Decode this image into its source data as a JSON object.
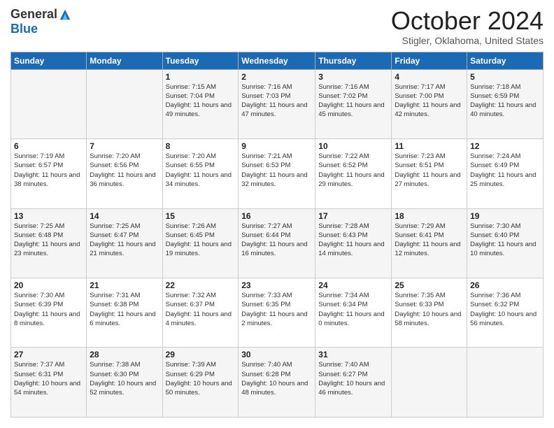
{
  "logo": {
    "general": "General",
    "blue": "Blue"
  },
  "header": {
    "month": "October 2024",
    "location": "Stigler, Oklahoma, United States"
  },
  "days_of_week": [
    "Sunday",
    "Monday",
    "Tuesday",
    "Wednesday",
    "Thursday",
    "Friday",
    "Saturday"
  ],
  "weeks": [
    [
      {
        "day": "",
        "sunrise": "",
        "sunset": "",
        "daylight": ""
      },
      {
        "day": "",
        "sunrise": "",
        "sunset": "",
        "daylight": ""
      },
      {
        "day": "1",
        "sunrise": "Sunrise: 7:15 AM",
        "sunset": "Sunset: 7:04 PM",
        "daylight": "Daylight: 11 hours and 49 minutes."
      },
      {
        "day": "2",
        "sunrise": "Sunrise: 7:16 AM",
        "sunset": "Sunset: 7:03 PM",
        "daylight": "Daylight: 11 hours and 47 minutes."
      },
      {
        "day": "3",
        "sunrise": "Sunrise: 7:16 AM",
        "sunset": "Sunset: 7:02 PM",
        "daylight": "Daylight: 11 hours and 45 minutes."
      },
      {
        "day": "4",
        "sunrise": "Sunrise: 7:17 AM",
        "sunset": "Sunset: 7:00 PM",
        "daylight": "Daylight: 11 hours and 42 minutes."
      },
      {
        "day": "5",
        "sunrise": "Sunrise: 7:18 AM",
        "sunset": "Sunset: 6:59 PM",
        "daylight": "Daylight: 11 hours and 40 minutes."
      }
    ],
    [
      {
        "day": "6",
        "sunrise": "Sunrise: 7:19 AM",
        "sunset": "Sunset: 6:57 PM",
        "daylight": "Daylight: 11 hours and 38 minutes."
      },
      {
        "day": "7",
        "sunrise": "Sunrise: 7:20 AM",
        "sunset": "Sunset: 6:56 PM",
        "daylight": "Daylight: 11 hours and 36 minutes."
      },
      {
        "day": "8",
        "sunrise": "Sunrise: 7:20 AM",
        "sunset": "Sunset: 6:55 PM",
        "daylight": "Daylight: 11 hours and 34 minutes."
      },
      {
        "day": "9",
        "sunrise": "Sunrise: 7:21 AM",
        "sunset": "Sunset: 6:53 PM",
        "daylight": "Daylight: 11 hours and 32 minutes."
      },
      {
        "day": "10",
        "sunrise": "Sunrise: 7:22 AM",
        "sunset": "Sunset: 6:52 PM",
        "daylight": "Daylight: 11 hours and 29 minutes."
      },
      {
        "day": "11",
        "sunrise": "Sunrise: 7:23 AM",
        "sunset": "Sunset: 6:51 PM",
        "daylight": "Daylight: 11 hours and 27 minutes."
      },
      {
        "day": "12",
        "sunrise": "Sunrise: 7:24 AM",
        "sunset": "Sunset: 6:49 PM",
        "daylight": "Daylight: 11 hours and 25 minutes."
      }
    ],
    [
      {
        "day": "13",
        "sunrise": "Sunrise: 7:25 AM",
        "sunset": "Sunset: 6:48 PM",
        "daylight": "Daylight: 11 hours and 23 minutes."
      },
      {
        "day": "14",
        "sunrise": "Sunrise: 7:25 AM",
        "sunset": "Sunset: 6:47 PM",
        "daylight": "Daylight: 11 hours and 21 minutes."
      },
      {
        "day": "15",
        "sunrise": "Sunrise: 7:26 AM",
        "sunset": "Sunset: 6:45 PM",
        "daylight": "Daylight: 11 hours and 19 minutes."
      },
      {
        "day": "16",
        "sunrise": "Sunrise: 7:27 AM",
        "sunset": "Sunset: 6:44 PM",
        "daylight": "Daylight: 11 hours and 16 minutes."
      },
      {
        "day": "17",
        "sunrise": "Sunrise: 7:28 AM",
        "sunset": "Sunset: 6:43 PM",
        "daylight": "Daylight: 11 hours and 14 minutes."
      },
      {
        "day": "18",
        "sunrise": "Sunrise: 7:29 AM",
        "sunset": "Sunset: 6:41 PM",
        "daylight": "Daylight: 11 hours and 12 minutes."
      },
      {
        "day": "19",
        "sunrise": "Sunrise: 7:30 AM",
        "sunset": "Sunset: 6:40 PM",
        "daylight": "Daylight: 11 hours and 10 minutes."
      }
    ],
    [
      {
        "day": "20",
        "sunrise": "Sunrise: 7:30 AM",
        "sunset": "Sunset: 6:39 PM",
        "daylight": "Daylight: 11 hours and 8 minutes."
      },
      {
        "day": "21",
        "sunrise": "Sunrise: 7:31 AM",
        "sunset": "Sunset: 6:38 PM",
        "daylight": "Daylight: 11 hours and 6 minutes."
      },
      {
        "day": "22",
        "sunrise": "Sunrise: 7:32 AM",
        "sunset": "Sunset: 6:37 PM",
        "daylight": "Daylight: 11 hours and 4 minutes."
      },
      {
        "day": "23",
        "sunrise": "Sunrise: 7:33 AM",
        "sunset": "Sunset: 6:35 PM",
        "daylight": "Daylight: 11 hours and 2 minutes."
      },
      {
        "day": "24",
        "sunrise": "Sunrise: 7:34 AM",
        "sunset": "Sunset: 6:34 PM",
        "daylight": "Daylight: 11 hours and 0 minutes."
      },
      {
        "day": "25",
        "sunrise": "Sunrise: 7:35 AM",
        "sunset": "Sunset: 6:33 PM",
        "daylight": "Daylight: 10 hours and 58 minutes."
      },
      {
        "day": "26",
        "sunrise": "Sunrise: 7:36 AM",
        "sunset": "Sunset: 6:32 PM",
        "daylight": "Daylight: 10 hours and 56 minutes."
      }
    ],
    [
      {
        "day": "27",
        "sunrise": "Sunrise: 7:37 AM",
        "sunset": "Sunset: 6:31 PM",
        "daylight": "Daylight: 10 hours and 54 minutes."
      },
      {
        "day": "28",
        "sunrise": "Sunrise: 7:38 AM",
        "sunset": "Sunset: 6:30 PM",
        "daylight": "Daylight: 10 hours and 52 minutes."
      },
      {
        "day": "29",
        "sunrise": "Sunrise: 7:39 AM",
        "sunset": "Sunset: 6:29 PM",
        "daylight": "Daylight: 10 hours and 50 minutes."
      },
      {
        "day": "30",
        "sunrise": "Sunrise: 7:40 AM",
        "sunset": "Sunset: 6:28 PM",
        "daylight": "Daylight: 10 hours and 48 minutes."
      },
      {
        "day": "31",
        "sunrise": "Sunrise: 7:40 AM",
        "sunset": "Sunset: 6:27 PM",
        "daylight": "Daylight: 10 hours and 46 minutes."
      },
      {
        "day": "",
        "sunrise": "",
        "sunset": "",
        "daylight": ""
      },
      {
        "day": "",
        "sunrise": "",
        "sunset": "",
        "daylight": ""
      }
    ]
  ]
}
